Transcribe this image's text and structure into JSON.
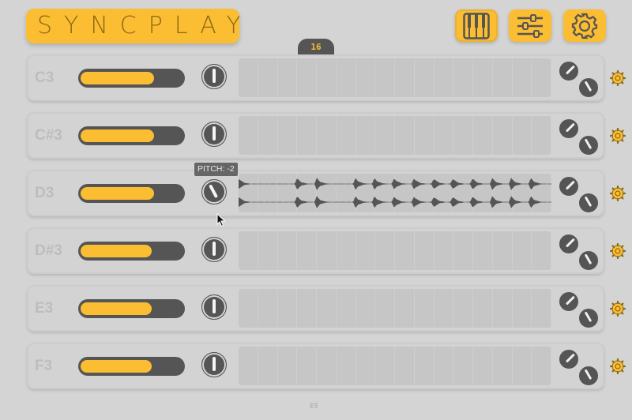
{
  "app": {
    "title": "SYNCPLAY"
  },
  "toolbar": {
    "buttons": [
      {
        "name": "piano-button",
        "icon": "piano-icon",
        "active": true
      },
      {
        "name": "mixer-button",
        "icon": "sliders-icon",
        "active": false
      },
      {
        "name": "settings-button",
        "icon": "gear-icon",
        "active": false
      }
    ]
  },
  "step_count": "16",
  "colors": {
    "accent": "#fbbd32",
    "dark": "#555555",
    "panel": "#d3d3d3",
    "muted_text": "#bdbdbd"
  },
  "rows": [
    {
      "note": "C3",
      "volume": 0.72,
      "pitch_knob": 0,
      "has_sample": false
    },
    {
      "note": "C#3",
      "volume": 0.72,
      "pitch_knob": 0,
      "has_sample": false
    },
    {
      "note": "D3",
      "volume": 0.72,
      "pitch_knob": -2,
      "has_sample": true
    },
    {
      "note": "D#3",
      "volume": 0.7,
      "pitch_knob": 0,
      "has_sample": false
    },
    {
      "note": "E3",
      "volume": 0.7,
      "pitch_knob": 0,
      "has_sample": false
    },
    {
      "note": "F3",
      "volume": 0.7,
      "pitch_knob": 0,
      "has_sample": false
    }
  ],
  "tooltip": {
    "text": "PITCH: -2"
  },
  "footer": {
    "page": "E5"
  }
}
